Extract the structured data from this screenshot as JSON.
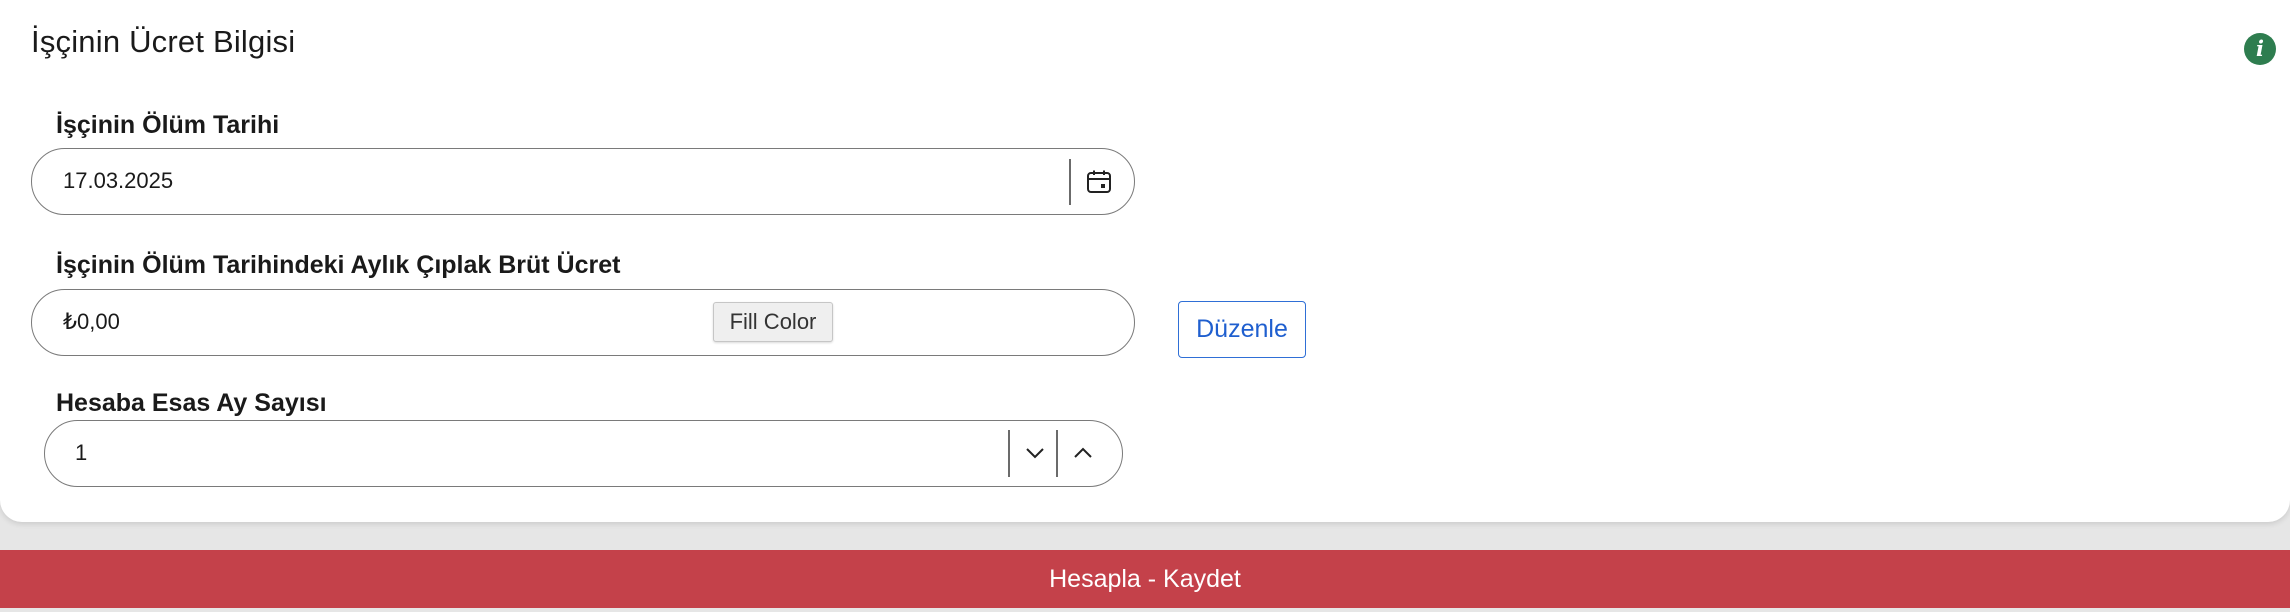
{
  "card": {
    "title": "İşçinin Ücret Bilgisi",
    "info_icon": "info-icon"
  },
  "death_date": {
    "label": "İşçinin Ölüm Tarihi",
    "value": "17.03.2025",
    "icon": "calendar-icon"
  },
  "gross_wage": {
    "label": "İşçinin Ölüm Tarihindeki Aylık Çıplak Brüt Ücret",
    "value": "₺0,00"
  },
  "tooltip": {
    "text": "Fill Color"
  },
  "edit_button": {
    "label": "Düzenle"
  },
  "month_count": {
    "label": "Hesaba Esas Ay Sayısı",
    "value": "1",
    "decrement_icon": "chevron-down-icon",
    "increment_icon": "chevron-up-icon"
  },
  "submit": {
    "label": "Hesapla - Kaydet"
  },
  "colors": {
    "accent_red": "#c4414a",
    "info_green": "#2e7d4f",
    "link_blue": "#1f5fcf"
  }
}
